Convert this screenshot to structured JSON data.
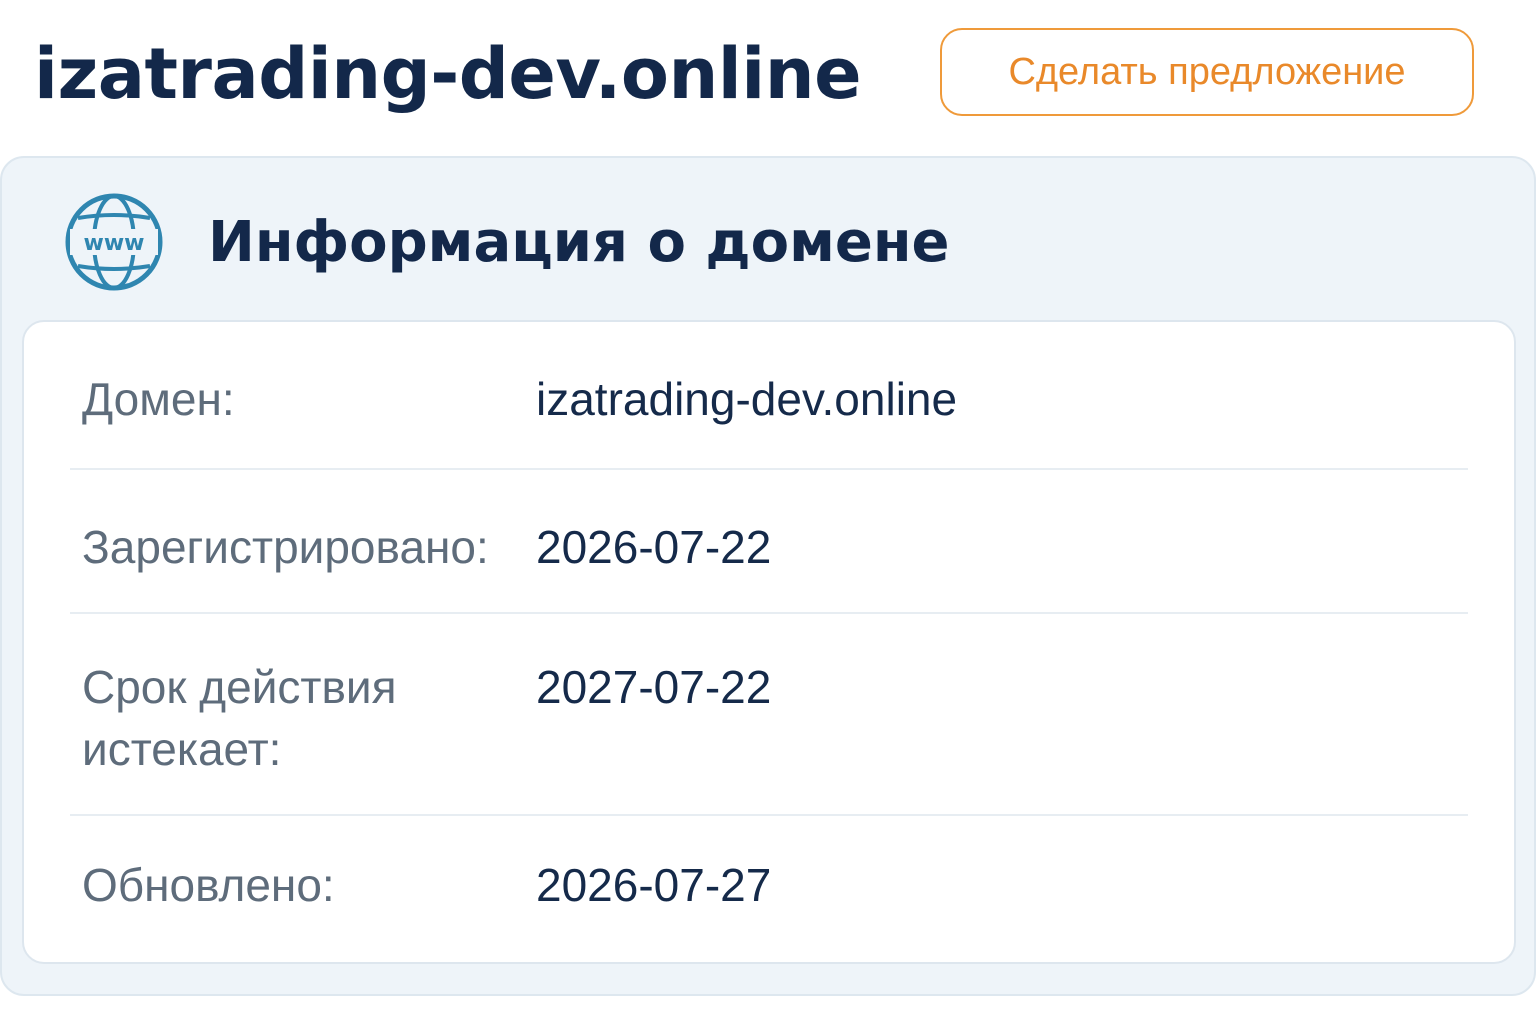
{
  "header": {
    "site_title": "izatrading-dev.online",
    "offer_button_label": "Сделать предложение"
  },
  "panel": {
    "icon": "www-globe-icon",
    "icon_text": "www",
    "title": "Информация о домене",
    "rows": [
      {
        "label": "Домен:",
        "value": "izatrading-dev.online"
      },
      {
        "label": "Зарегистрировано:",
        "value": "2026-07-22"
      },
      {
        "label": "Срок действия истекает:",
        "value": "2027-07-22"
      },
      {
        "label": "Обновлено:",
        "value": "2026-07-27"
      }
    ]
  },
  "colors": {
    "title_text": "#13284a",
    "accent_orange": "#e9892a",
    "globe_blue": "#2f86b0",
    "panel_background": "#eef4f9",
    "label_gray": "#5e6c7b"
  }
}
